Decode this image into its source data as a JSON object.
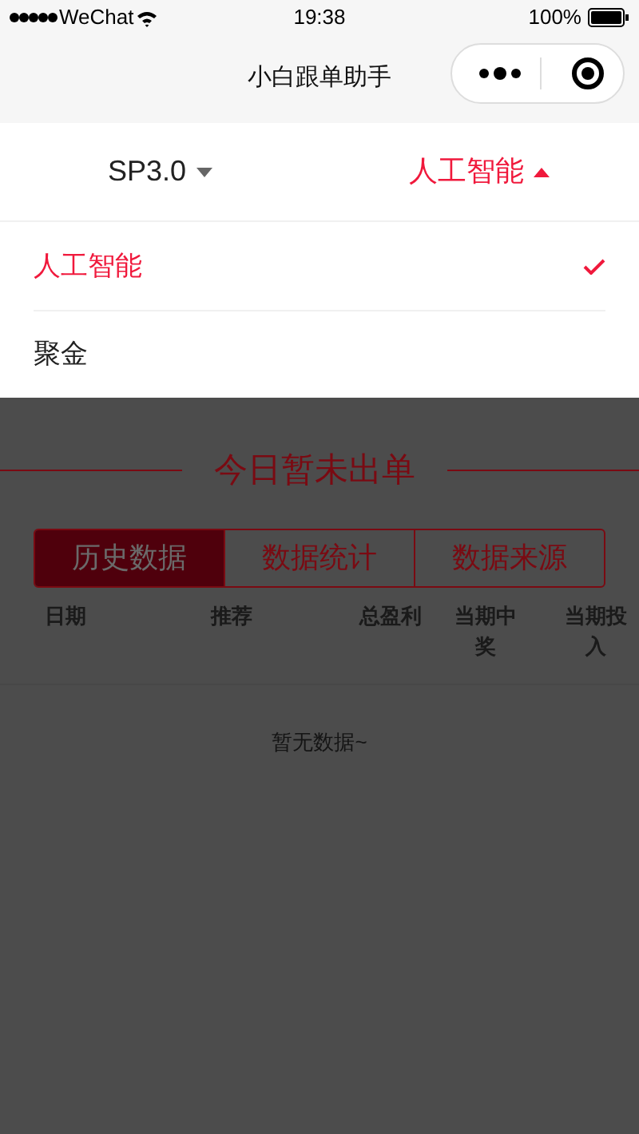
{
  "status_bar": {
    "carrier": "WeChat",
    "time": "19:38",
    "battery": "100%"
  },
  "nav": {
    "title": "小白跟单助手"
  },
  "filters": [
    {
      "label": "SP3.0",
      "expanded": false
    },
    {
      "label": "人工智能",
      "expanded": true
    }
  ],
  "dropdown": [
    {
      "label": "人工智能",
      "selected": true
    },
    {
      "label": "聚金",
      "selected": false
    }
  ],
  "banner": {
    "title": "今日暂未出单"
  },
  "tabs": [
    {
      "label": "历史数据",
      "selected": true
    },
    {
      "label": "数据统计",
      "selected": false
    },
    {
      "label": "数据来源",
      "selected": false
    }
  ],
  "table": {
    "columns": [
      "日期",
      "推荐",
      "总盈利",
      "当期中奖",
      "当期投入"
    ],
    "empty_text": "暂无数据~"
  }
}
